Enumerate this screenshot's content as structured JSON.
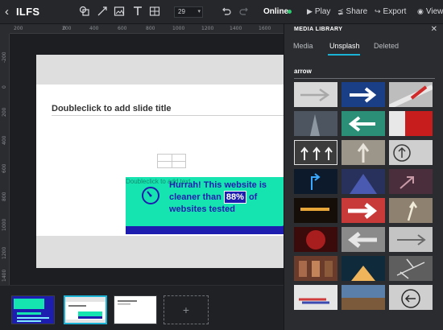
{
  "app": {
    "title": "ILFS",
    "back_icon": "chevron-left-icon"
  },
  "toolbar": {
    "zoom_value": "29",
    "status": "Online",
    "status_color": "#2ecc71",
    "play_label": "Play",
    "share_label": "Share",
    "export_label": "Export",
    "view_label": "View",
    "tools": [
      "shapes-icon",
      "line-icon",
      "image-icon",
      "text-icon",
      "table-icon",
      "undo-icon",
      "redo-icon"
    ]
  },
  "rulers": {
    "top": [
      "200",
      "0",
      "200",
      "400",
      "600",
      "800",
      "1000",
      "1200",
      "1400",
      "1600"
    ],
    "left": [
      "-200",
      "0",
      "200",
      "400",
      "600",
      "800",
      "1000",
      "1200",
      "1400"
    ]
  },
  "slide": {
    "title_placeholder": "Doubleclick to add slide title",
    "banner_ghost_text": "Doubleclick to add text",
    "banner_line1": "Hurrah! This website is",
    "banner_line2_pre": "cleaner than ",
    "banner_percent": "88%",
    "banner_line2_post": " of",
    "banner_line3": "websites tested",
    "accent_teal": "#16e4b0",
    "accent_blue": "#1d1db0"
  },
  "filmstrip": {
    "add_label": "+",
    "selected_index": 1
  },
  "media_library": {
    "title": "MEDIA LIBRARY",
    "tabs": [
      "Media",
      "Unsplash",
      "Deleted"
    ],
    "active_tab": "Unsplash",
    "search_query": "arrow",
    "accent": "#1ab3d6"
  }
}
